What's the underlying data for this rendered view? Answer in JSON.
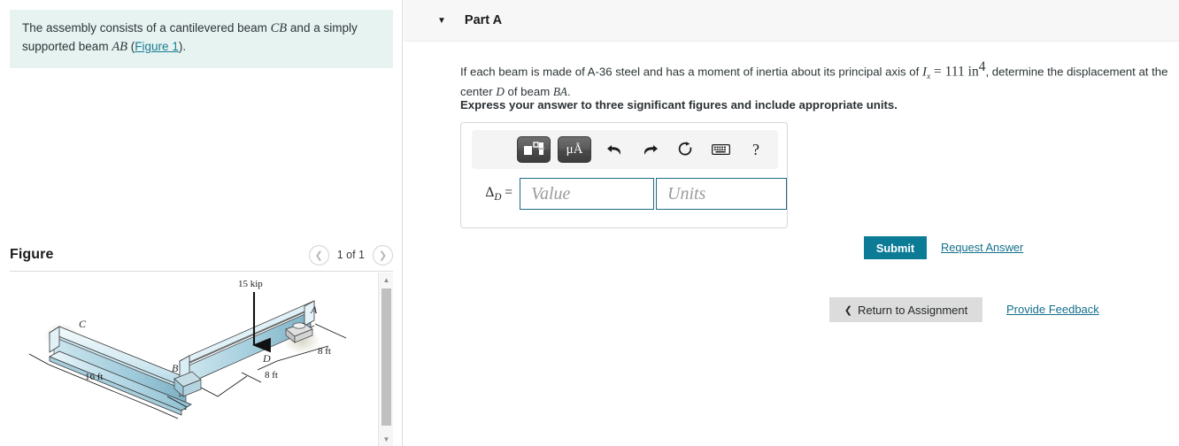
{
  "left": {
    "intro": {
      "text_1": "The assembly consists of a cantilevered beam ",
      "beam_cb": "CB",
      "text_2": " and a simply supported beam ",
      "beam_ab": "AB",
      "paren_open": " (",
      "figure_link": "Figure 1",
      "paren_close": ")."
    },
    "figure_title": "Figure",
    "pager": {
      "prev_icon": "chevron-left-icon",
      "label": "1 of 1",
      "next_icon": "chevron-right-icon"
    },
    "scrollbar": {
      "up_icon": "caret-up-icon",
      "down_icon": "caret-down-icon"
    }
  },
  "diagram": {
    "load_label": "15 kip",
    "point_A": "A",
    "point_B": "B",
    "point_C": "C",
    "point_D": "D",
    "dim_16ft": "16 ft",
    "dim_8ft_left": "8 ft",
    "dim_8ft_right": "8 ft",
    "beam_color_light": "#e3f1f6",
    "beam_color_mid": "#bcdde9",
    "beam_color_dark": "#8fc3d6"
  },
  "right": {
    "part_header": {
      "caret_icon": "caret-down-icon",
      "title": "Part A"
    },
    "question": {
      "line_a": "If each beam is made of A-36 steel and has a moment of inertia about its principal axis of ",
      "symbol_I": "I",
      "symbol_I_sub": "x",
      "equals": "=",
      "value": "111",
      "unit": "in",
      "unit_sup": "4",
      "line_b": ", determine the displacement at the center ",
      "point_D": "D",
      "line_c": " of beam ",
      "beam_BA": "BA",
      "line_d": ".",
      "bold_instruction": "Express your answer to three significant figures and include appropriate units."
    },
    "toolbar": {
      "template_icon": "math-template-icon",
      "units_icon": "micro-angstrom-units-icon",
      "units_label": "μÅ",
      "undo_icon": "undo-arrow-icon",
      "redo_icon": "redo-arrow-icon",
      "reset_icon": "reset-circular-arrow-icon",
      "keyboard_icon": "keyboard-icon",
      "help_icon": "help-question-icon",
      "help_label": "?"
    },
    "answer": {
      "label_delta": "Δ",
      "label_sub": "D",
      "label_eq": "=",
      "value_placeholder": "Value",
      "units_placeholder": "Units",
      "value_current": "",
      "units_current": ""
    },
    "submit_label": "Submit",
    "request_answer_label": "Request Answer",
    "return_chevron": "❮",
    "return_label": "Return to Assignment",
    "feedback_label": "Provide Feedback"
  },
  "colors": {
    "accent_teal": "#0b7b96",
    "link_teal": "#136f8c",
    "info_bg": "#e6f3f1",
    "header_bg": "#f7f7f7",
    "field_border": "#1b6e85"
  }
}
